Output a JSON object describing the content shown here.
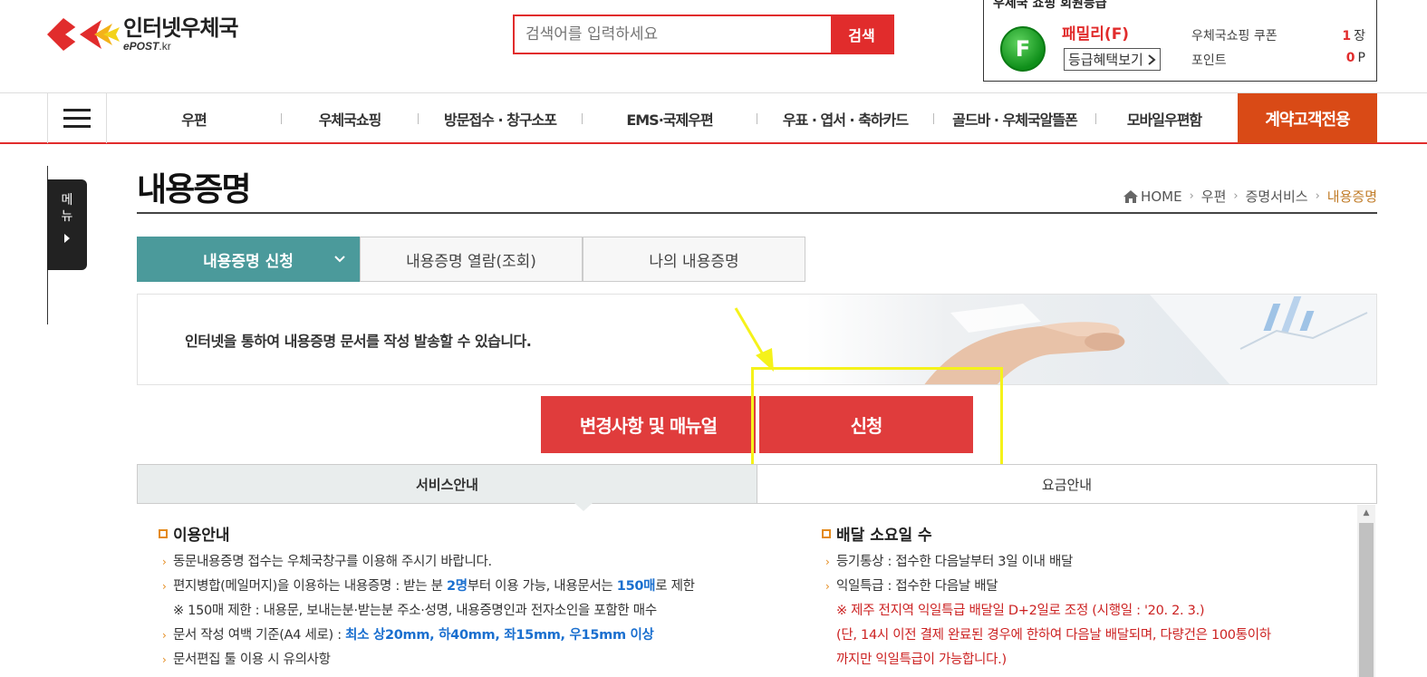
{
  "header": {
    "logo_title": "인터넷우체국",
    "logo_sub_bold": "ePOST",
    "logo_sub_light": ".kr",
    "search": {
      "placeholder": "검색어를 입력하세요",
      "button": "검색"
    }
  },
  "member": {
    "title": "우체국 쇼핑 회원등급",
    "grade_letter": "F",
    "grade_name": "패밀리(F)",
    "benefit_link": "등급혜택보기",
    "coupon_label": "우체국쇼핑 쿠폰",
    "coupon_count": "1",
    "coupon_unit": "장",
    "point_label": "포인트",
    "point_value": "0",
    "point_unit": "P"
  },
  "nav": {
    "items": [
      "우편",
      "우체국쇼핑",
      "방문접수 · 창구소포",
      "EMS·국제우편",
      "우표 · 엽서 · 축하카드",
      "골드바 · 우체국알뜰폰",
      "모바일우편함"
    ],
    "contract": "계약고객전용"
  },
  "side_menu": {
    "label_1": "메",
    "label_2": "뉴"
  },
  "page": {
    "title": "내용증명",
    "breadcrumb": [
      "HOME",
      "우편",
      "증명서비스",
      "내용증명"
    ]
  },
  "tabs": [
    "내용증명 신청",
    "내용증명 열람(조회)",
    "나의 내용증명"
  ],
  "banner": {
    "text": "인터넷을 통하여 내용증명 문서를 작성 발송할 수 있습니다."
  },
  "buttons": {
    "manual": "변경사항 및 매뉴얼",
    "apply": "신청"
  },
  "service_tabs": [
    "서비스안내",
    "요금안내"
  ],
  "usage": {
    "heading": "이용안내",
    "item1": "동문내용증명 접수는 우체국창구를 이용해 주시기 바랍니다.",
    "item2_a": "편지병합(메일머지)을 이용하는 내용증명 : 받는 분 ",
    "item2_b": "2명",
    "item2_c": "부터 이용 가능, 내용문서는 ",
    "item2_d": "150매",
    "item2_e": "로 제한",
    "note": "※ 150매 제한 : 내용문, 보내는분·받는분 주소·성명, 내용증명인과 전자소인을 포함한 매수",
    "item3_a": "문서 작성 여백 기준(A4 세로) : ",
    "item3_b": "최소 상20mm, 하40mm, 좌15mm, 우15mm 이상",
    "item4": "문서편집 툴 이용 시 유의사항"
  },
  "delivery": {
    "heading": "배달 소요일 수",
    "item1": "등기통상 : 접수한 다음날부터 3일 이내 배달",
    "item2": "익일특급 : 접수한 다음날 배달",
    "note1": "※ 제주 전지역 익일특급 배달일 D+2일로 조정 (시행일 : '20. 2. 3.)",
    "note2": "(단, 14시 이전 결제 완료된 경우에 한하여 다음날 배달되며, 다량건은 100통이하",
    "note3": "까지만 익일특급이 가능합니다.)"
  },
  "colors": {
    "brand_red": "#e12c2c",
    "contract_orange": "#d94a16",
    "tab_teal": "#4b9a9b",
    "highlight_yellow": "#f5f21a",
    "bullet_orange": "#e48a1c",
    "link_blue": "#1a6fcf"
  },
  "icons": {
    "logo": "epost-wing-logo",
    "menu": "hamburger-icon",
    "home": "home-icon",
    "tab_chevron": "chevron-down-icon"
  }
}
